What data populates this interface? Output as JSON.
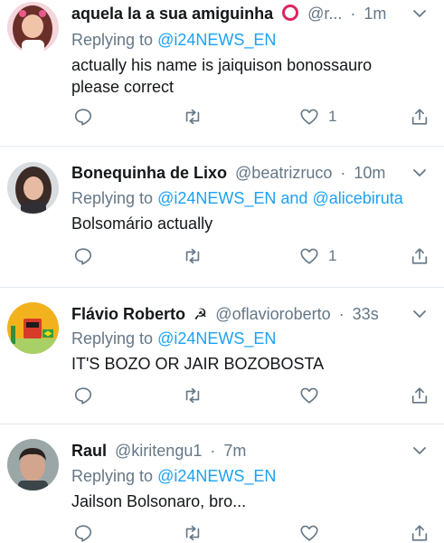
{
  "tweets": [
    {
      "name": "aquela la a sua amiguinha",
      "handle": "@r...",
      "time": "1m",
      "reply_prefix": "Replying to",
      "mention1": "@i24NEWS_EN",
      "conj": "",
      "mention2": "",
      "text_lines": [
        "actually his name is jaiquison bonossauro",
        "please correct"
      ],
      "like_count": "1"
    },
    {
      "name": "Bonequinha de Lixo",
      "handle": "@beatrizruco",
      "time": "10m",
      "reply_prefix": "Replying to",
      "mention1": "@i24NEWS_EN",
      "conj": "and",
      "mention2": "@alicebiruta",
      "text_lines": [
        "Bolsomário actually"
      ],
      "like_count": "1"
    },
    {
      "name": "Flávio Roberto",
      "handle": "@oflavioroberto",
      "time": "33s",
      "reply_prefix": "Replying to",
      "mention1": "@i24NEWS_EN",
      "conj": "",
      "mention2": "",
      "text_lines": [
        "IT'S BOZO OR JAIR BOZOBOSTA"
      ],
      "like_count": ""
    },
    {
      "name": "Raul",
      "handle": "@kiritengu1",
      "time": "7m",
      "reply_prefix": "Replying to",
      "mention1": "@i24NEWS_EN",
      "conj": "",
      "mention2": "",
      "text_lines": [
        "Jailson Bolsonaro, bro..."
      ],
      "like_count": ""
    }
  ],
  "colors": {
    "text": "#14171a",
    "secondary": "#657786",
    "link": "#1da1f2",
    "divider": "#e1e8ed",
    "ring_badge": "#e0245e"
  },
  "icons": {
    "reply": "reply-icon",
    "retweet": "retweet-icon",
    "like": "like-icon",
    "share": "share-icon",
    "more": "chevron-down-icon"
  }
}
